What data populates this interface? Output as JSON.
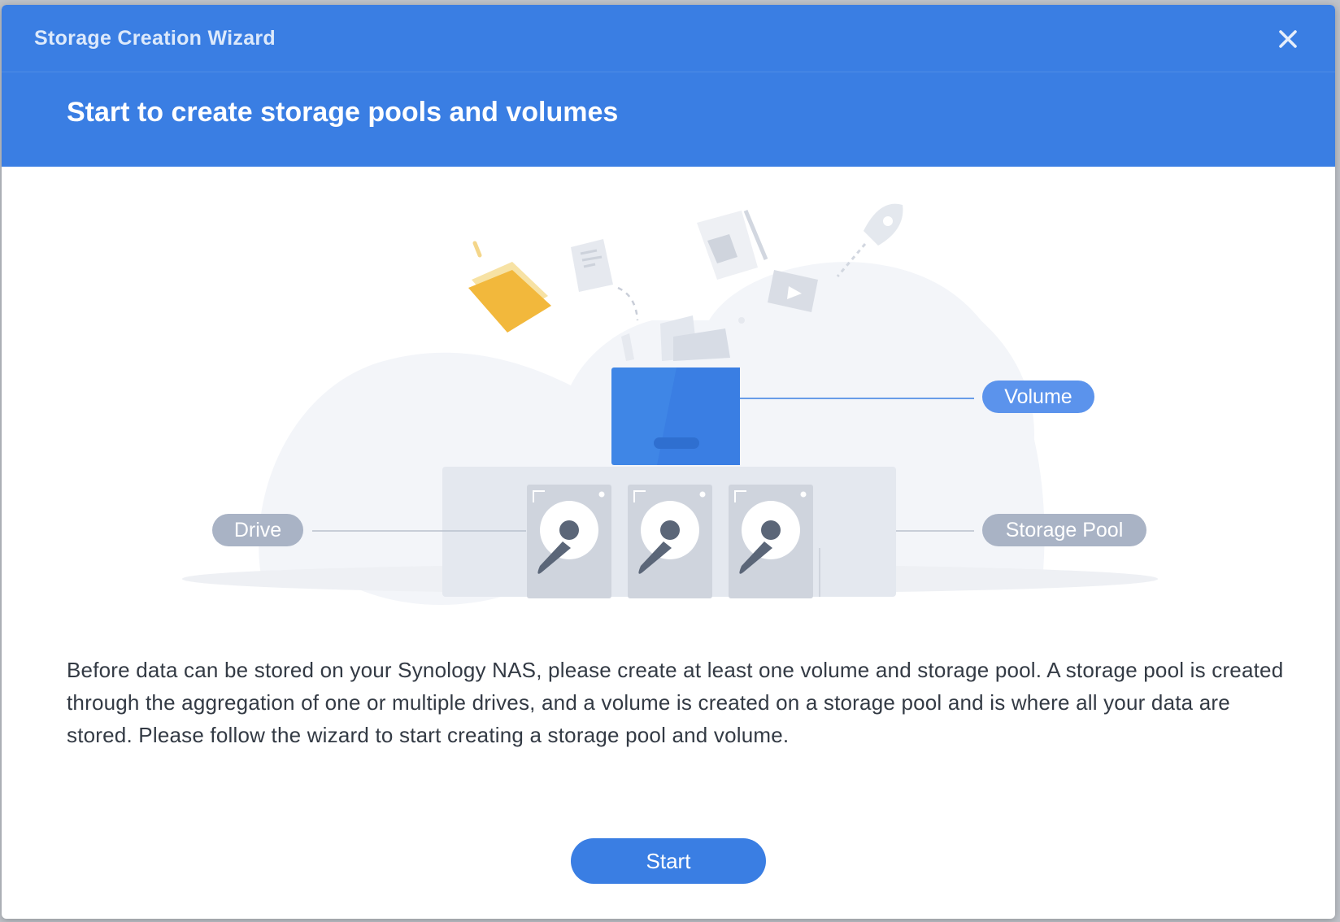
{
  "window": {
    "title": "Storage Creation Wizard"
  },
  "header": {
    "heading": "Start to create storage pools and volumes"
  },
  "illustration": {
    "labels": {
      "volume": "Volume",
      "drive": "Drive",
      "storage_pool": "Storage Pool"
    }
  },
  "description": "Before data can be stored on your Synology NAS, please create at least one volume and storage pool. A storage pool is created through the aggregation of one or multiple drives, and a volume is created on a storage pool and is where all your data are stored. Please follow the wizard to start creating a storage pool and volume.",
  "actions": {
    "start_label": "Start"
  },
  "colors": {
    "accent": "#3a7ee3",
    "volume_label": "#5b93ec",
    "muted_label": "#a9b3c5"
  }
}
